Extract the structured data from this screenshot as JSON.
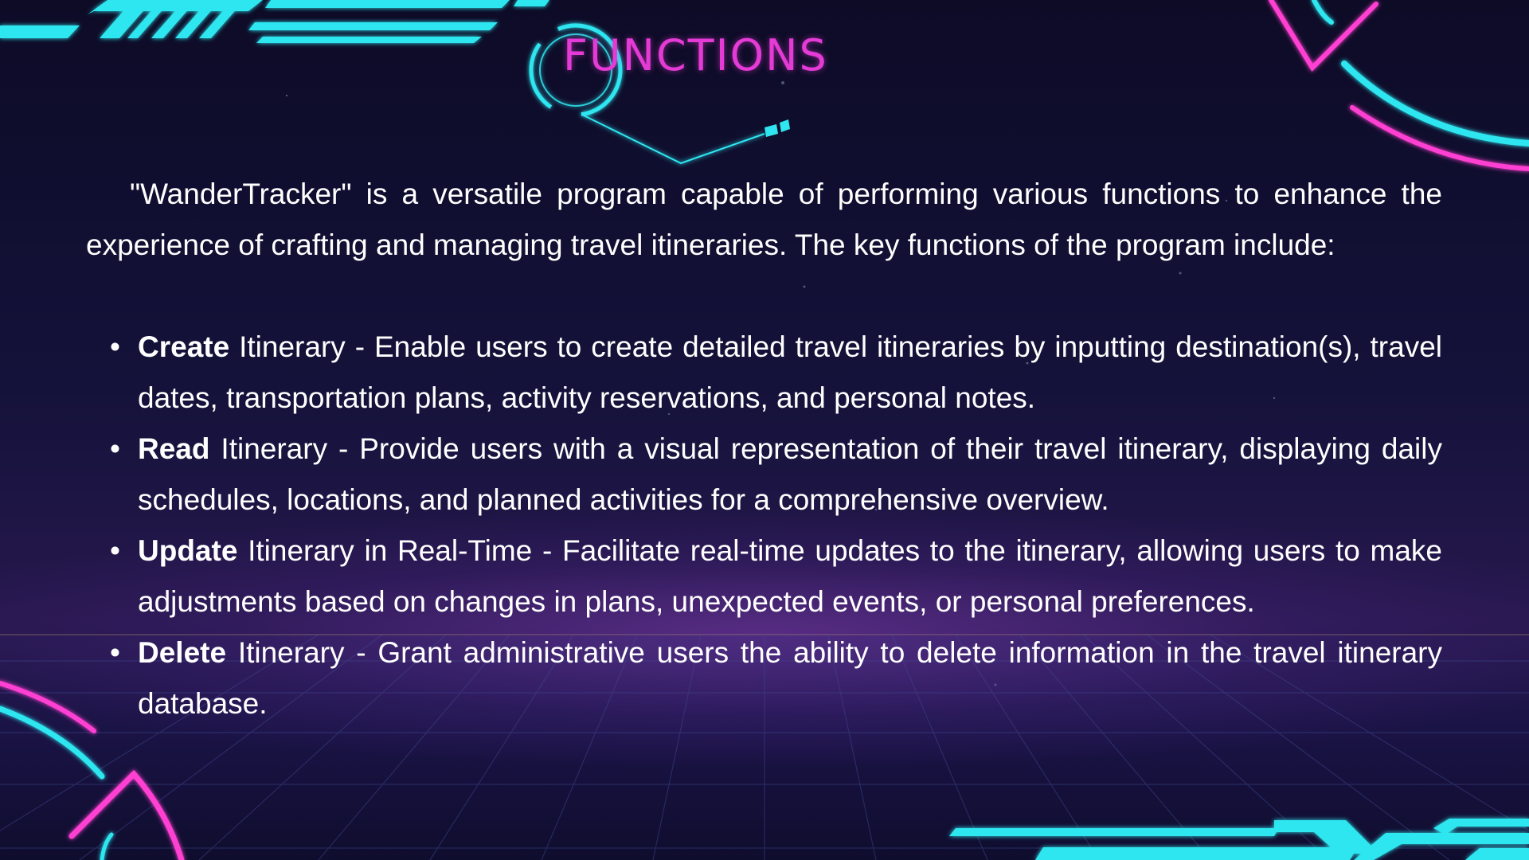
{
  "slide": {
    "title": "FUNCTIONS",
    "intro": "\"WanderTracker\" is a versatile program capable of performing various functions to enhance the experience of crafting and managing travel itineraries. The key functions of the program include:",
    "bullet_glyph": "•",
    "functions": [
      {
        "term": "Create",
        "description": " Itinerary - Enable users to create detailed travel itineraries by inputting destination(s), travel dates, transportation plans, activity reservations, and personal notes."
      },
      {
        "term": "Read",
        "description": " Itinerary - Provide users with a visual representation of their travel itinerary, displaying daily schedules, locations, and planned activities for a comprehensive overview."
      },
      {
        "term": "Update",
        "description": " Itinerary in Real-Time - Facilitate real-time updates to the itinerary, allowing users to make adjustments based on changes in plans, unexpected events, or personal preferences."
      },
      {
        "term": "Delete",
        "description": " Itinerary - Grant administrative users the ability to delete information in the travel itinerary database."
      }
    ]
  },
  "colors": {
    "background": "#0c0a28",
    "title_magenta": "#e43ad6",
    "neon_cyan": "#2fe6f0",
    "neon_pink": "#ff3fd2",
    "text": "#ffffff"
  }
}
